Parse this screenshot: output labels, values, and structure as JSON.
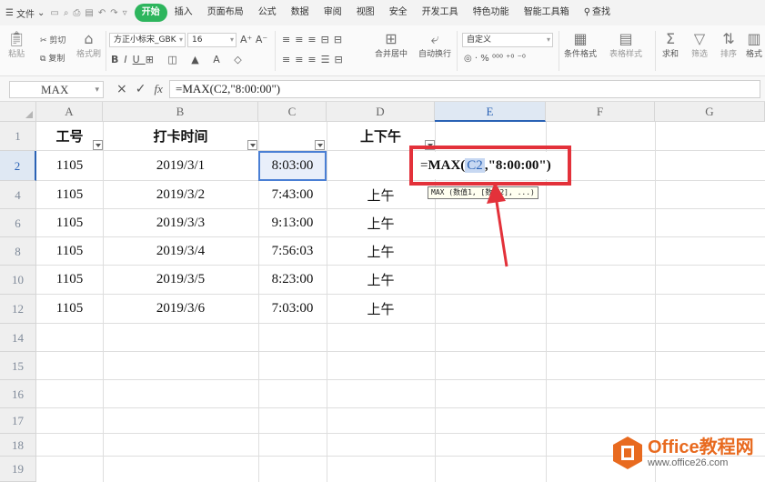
{
  "menubar": {
    "file_label": "文件",
    "tabs": [
      "开始",
      "插入",
      "页面布局",
      "公式",
      "数据",
      "审阅",
      "视图",
      "安全",
      "开发工具",
      "特色功能",
      "智能工具箱"
    ],
    "active_tab": "开始",
    "search_label": "查找"
  },
  "ribbon": {
    "paste_label": "粘贴",
    "cut_label": "剪切",
    "copy_label": "复制",
    "format_painter_label": "格式刷",
    "font_name": "方正小标宋_GBK",
    "font_size": "16",
    "merge_label": "合并居中",
    "wrap_label": "自动换行",
    "number_format": "自定义",
    "cond_format_label": "条件格式",
    "table_style_label": "表格样式",
    "sum_label": "求和",
    "filter_label": "筛选",
    "sort_label": "排序",
    "format_label": "格式"
  },
  "formula_bar": {
    "name_box": "MAX",
    "formula": "=MAX(C2,\"8:00:00\")"
  },
  "sheet": {
    "columns": [
      "A",
      "B",
      "C",
      "D",
      "E",
      "F",
      "G"
    ],
    "selected_column": "E",
    "rows": [
      "1",
      "2",
      "4",
      "6",
      "8",
      "10",
      "12",
      "14",
      "15",
      "16",
      "17",
      "18",
      "19"
    ],
    "selected_row": "2",
    "headers": {
      "a": "工号",
      "b": "打卡时间",
      "d": "上下午"
    },
    "data": [
      {
        "id": "1105",
        "date": "2019/3/1",
        "time": "8:03:00",
        "ampm": ""
      },
      {
        "id": "1105",
        "date": "2019/3/2",
        "time": "7:43:00",
        "ampm": "上午"
      },
      {
        "id": "1105",
        "date": "2019/3/3",
        "time": "9:13:00",
        "ampm": "上午"
      },
      {
        "id": "1105",
        "date": "2019/3/4",
        "time": "7:56:03",
        "ampm": "上午"
      },
      {
        "id": "1105",
        "date": "2019/3/5",
        "time": "8:23:00",
        "ampm": "上午"
      },
      {
        "id": "1105",
        "date": "2019/3/6",
        "time": "7:03:00",
        "ampm": "上午"
      }
    ],
    "edit_cell": {
      "prefix": "=",
      "fn": "MAX(",
      "ref": "C2",
      "rest": ",\"8:00:00\")"
    },
    "tooltip": "MAX (数值1, [数值2], ...)"
  },
  "colors": {
    "active_tab": "#2db55d",
    "highlight": "#e3313a",
    "selection": "#4a7fd4"
  },
  "watermark": {
    "title": "Office教程网",
    "url": "www.office26.com"
  }
}
